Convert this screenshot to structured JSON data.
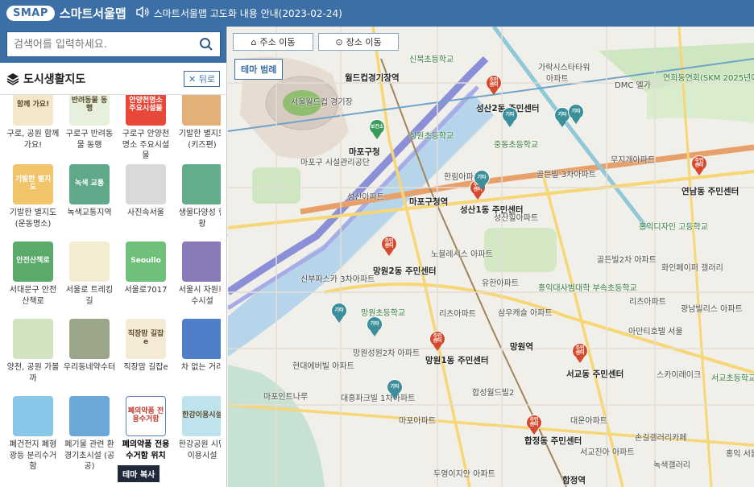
{
  "header": {
    "logo": "SMAP",
    "app_title": "스마트서울맵",
    "notice": "스마트서울맵 고도화 내용 안내(2023-02-24)"
  },
  "search": {
    "placeholder": "검색어를 입력하세요."
  },
  "section": {
    "title": "도시생활지도",
    "back_label": "뒤로"
  },
  "tiles": [
    {
      "label": "구로, 공원 함께 가요!",
      "ico": "함께 가요!",
      "color": "#f3e6c9"
    },
    {
      "label": "구로구 반려동물 동행",
      "ico": "반려동물 동행",
      "color": "#e6f0dc"
    },
    {
      "label": "구로구 안양천명소 주요시설물",
      "ico": "안양천명소 주요시설물",
      "color": "#e8483a"
    },
    {
      "label": "기발한 별지도 (키즈편)",
      "ico": "",
      "color": "#e2b178"
    },
    {
      "label": "기발한 별지도 (운동명소)",
      "ico": "기발한 별지도",
      "color": "#f2c46a"
    },
    {
      "label": "녹색교통지역",
      "ico": "녹색 교통",
      "color": "#5fa889"
    },
    {
      "label": "사진속서울",
      "ico": "",
      "color": "#d9d9d9"
    },
    {
      "label": "생물다양성 현황",
      "ico": "",
      "color": "#63ad8a"
    },
    {
      "label": "서대문구 안전산책로",
      "ico": "안전산책로",
      "color": "#5aaa6a"
    },
    {
      "label": "서울로 트레킹길",
      "ico": "",
      "color": "#f4ecd0"
    },
    {
      "label": "서울로7017",
      "ico": "Seoullo",
      "color": "#6fc07a"
    },
    {
      "label": "서울시 자원회수시설",
      "ico": "",
      "color": "#8a7ab8"
    },
    {
      "label": "양천, 공원 가볼까",
      "ico": "",
      "color": "#cfe4bf"
    },
    {
      "label": "우리동네약수터",
      "ico": "",
      "color": "#9aa58a"
    },
    {
      "label": "직장맘 길잡e",
      "ico": "직장맘 길잡e",
      "color": "#f4ead6"
    },
    {
      "label": "차 없는 거리",
      "ico": "",
      "color": "#4f7fc9"
    },
    {
      "label": "폐건전지 폐형광등 분리수거함",
      "ico": "",
      "color": "#8ac6e8"
    },
    {
      "label": "폐기물 관련 환경기초시설 (공공)",
      "ico": "",
      "color": "#6aa8d8"
    },
    {
      "label": "폐의약품 전용 수거함 위치",
      "ico": "폐의약품 전용수거함",
      "color": "#ffffff"
    },
    {
      "label": "한강공원 시민이용시설",
      "ico": "한강이용시설",
      "color": "#bfe3ec"
    }
  ],
  "tooltip": "테마 복사",
  "map": {
    "address_move": "주소 이동",
    "place_move": "장소 이동",
    "theme_legend": "테마 범례",
    "labels": [
      "신북초등학교",
      "가락시스타타워",
      "아파트",
      "DMC 엘가",
      "연희동연회(SKM 2025년예정)",
      "월드컵경기장역",
      "서울월드컵 경기장",
      "성산2동 주민센터",
      "중동초등학교",
      "무지개아파트",
      "성원초등학교",
      "마포구청",
      "마포구 시설관리공단",
      "한림아파트",
      "골든빌 3차아파트",
      "연남동 주민센터",
      "성산아파트",
      "마포구청역",
      "성산1동 주민센터",
      "성산힐아파트",
      "홍익디자인 고등학교",
      "노블레시스 아파트",
      "신부파스카 3차아파트",
      "망원2동 주민센터",
      "골든빌2차 아파트",
      "화인페이퍼 갤러리",
      "유한아파트",
      "홍익대사범대학 부속초등학교",
      "리츠아파트",
      "망원초등학교",
      "리츠아파트",
      "삼우캐슬 아파트",
      "광남빌리스 아파트",
      "아만티호텔 서울",
      "망원1동 주민센터",
      "망원역",
      "망원성원2차 아파트",
      "현대에버빌 아파트",
      "서교동 주민센터",
      "스카이레이크",
      "서교초등학교",
      "마포인트나루",
      "대흥파크빌 1차아파트",
      "합성월드빌2",
      "대운아파트",
      "마포아파트",
      "합정동 주민센터",
      "서교진아 아파트",
      "손길갤러리카페",
      "녹색갤러리",
      "두영이지안 아파트",
      "합정역",
      "홍익 서울건"
    ]
  },
  "chart_data": null
}
